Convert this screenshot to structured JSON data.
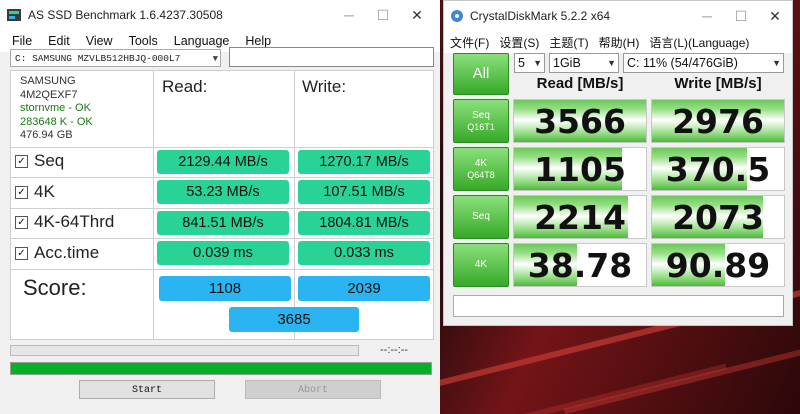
{
  "asssd": {
    "title": "AS SSD Benchmark 1.6.4237.30508",
    "menu": [
      "File",
      "Edit",
      "View",
      "Tools",
      "Language",
      "Help"
    ],
    "drive_select": "C: SAMSUNG MZVLB512HBJQ-000L7",
    "info": [
      "SAMSUNG",
      "4M2QEXF7",
      "stornvme - OK",
      "283648 K - OK",
      "476.94 GB"
    ],
    "read_header": "Read:",
    "write_header": "Write:",
    "rows": [
      {
        "label": "Seq",
        "read": "2129.44 MB/s",
        "write": "1270.17 MB/s"
      },
      {
        "label": "4K",
        "read": "53.23 MB/s",
        "write": "107.51 MB/s"
      },
      {
        "label": "4K-64Thrd",
        "read": "841.51 MB/s",
        "write": "1804.81 MB/s"
      },
      {
        "label": "Acc.time",
        "read": "0.039 ms",
        "write": "0.033 ms"
      }
    ],
    "score_label": "Score:",
    "score_read": "1108",
    "score_write": "2039",
    "score_total": "3685",
    "time": "--:--:--",
    "start": "Start",
    "abort": "Abort"
  },
  "cdm": {
    "title": "CrystalDiskMark 5.2.2 x64",
    "menu": [
      "文件(F)",
      "设置(S)",
      "主题(T)",
      "帮助(H)",
      "语言(L)(Language)"
    ],
    "runs": "5",
    "size": "1GiB",
    "drive": "C: 11% (54/476GiB)",
    "all_label": "All",
    "read_header": "Read [MB/s]",
    "write_header": "Write [MB/s]",
    "tests": [
      {
        "l1": "Seq",
        "l2": "Q16T1",
        "read": "3566",
        "write": "2976"
      },
      {
        "l1": "4K",
        "l2": "Q64T8",
        "read": "1105",
        "write": "370.5"
      },
      {
        "l1": "Seq",
        "l2": "",
        "read": "2214",
        "write": "2073"
      },
      {
        "l1": "4K",
        "l2": "",
        "read": "38.78",
        "write": "90.89"
      }
    ]
  },
  "window_icons": {
    "minimize": "minimize-icon",
    "maximize": "maximize-icon",
    "close": "close-icon"
  }
}
